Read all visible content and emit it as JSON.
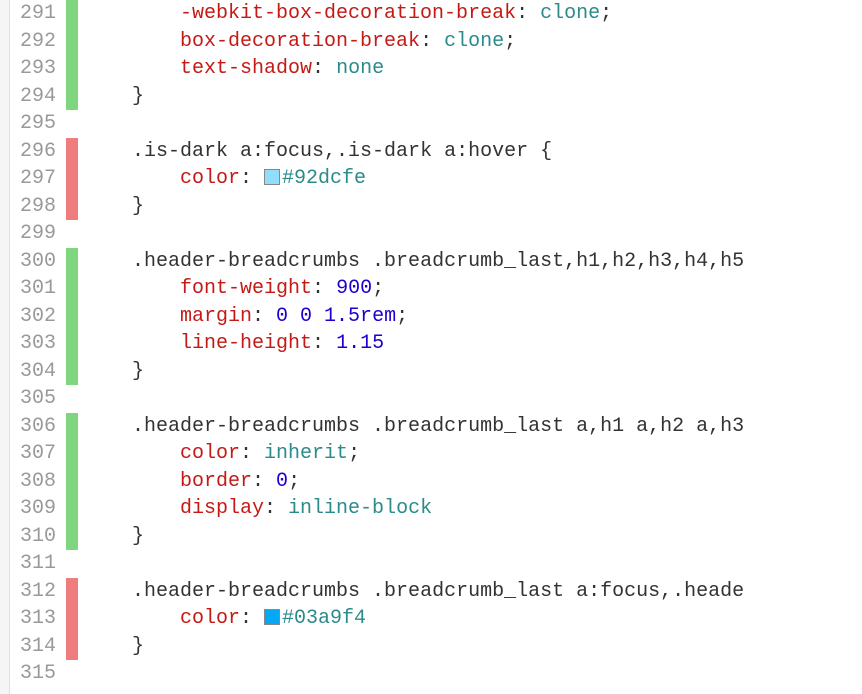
{
  "lines": [
    {
      "num": 291,
      "diff": "green",
      "tokens": [
        [
          "pad",
          "        "
        ],
        [
          "prop",
          "-webkit-box-decoration-break"
        ],
        [
          "punc",
          ": "
        ],
        [
          "val-kw",
          "clone"
        ],
        [
          "punc",
          ";"
        ]
      ]
    },
    {
      "num": 292,
      "diff": "green",
      "tokens": [
        [
          "pad",
          "        "
        ],
        [
          "prop",
          "box-decoration-break"
        ],
        [
          "punc",
          ": "
        ],
        [
          "val-kw",
          "clone"
        ],
        [
          "punc",
          ";"
        ]
      ]
    },
    {
      "num": 293,
      "diff": "green",
      "tokens": [
        [
          "pad",
          "        "
        ],
        [
          "prop",
          "text-shadow"
        ],
        [
          "punc",
          ": "
        ],
        [
          "val-kw",
          "none"
        ]
      ]
    },
    {
      "num": 294,
      "diff": "green",
      "tokens": [
        [
          "pad",
          "    "
        ],
        [
          "punc",
          "}"
        ]
      ]
    },
    {
      "num": 295,
      "diff": "",
      "tokens": []
    },
    {
      "num": 296,
      "diff": "red",
      "tokens": [
        [
          "pad",
          "    "
        ],
        [
          "sel",
          ".is-dark a:focus,.is-dark a:hover "
        ],
        [
          "punc",
          "{"
        ]
      ]
    },
    {
      "num": 297,
      "diff": "red",
      "tokens": [
        [
          "pad",
          "        "
        ],
        [
          "prop",
          "color"
        ],
        [
          "punc",
          ": "
        ],
        [
          "swatch",
          "#92dcfe"
        ],
        [
          "hex",
          "#92dcfe"
        ]
      ]
    },
    {
      "num": 298,
      "diff": "red",
      "tokens": [
        [
          "pad",
          "    "
        ],
        [
          "punc",
          "}"
        ]
      ]
    },
    {
      "num": 299,
      "diff": "",
      "tokens": []
    },
    {
      "num": 300,
      "diff": "green",
      "tokens": [
        [
          "pad",
          "    "
        ],
        [
          "sel",
          ".header-breadcrumbs .breadcrumb_last,h1,h2,h3,h4,h5"
        ]
      ]
    },
    {
      "num": 301,
      "diff": "green",
      "tokens": [
        [
          "pad",
          "        "
        ],
        [
          "prop",
          "font-weight"
        ],
        [
          "punc",
          ": "
        ],
        [
          "val-num",
          "900"
        ],
        [
          "punc",
          ";"
        ]
      ]
    },
    {
      "num": 302,
      "diff": "green",
      "tokens": [
        [
          "pad",
          "        "
        ],
        [
          "prop",
          "margin"
        ],
        [
          "punc",
          ": "
        ],
        [
          "val-num",
          "0 0 1.5rem"
        ],
        [
          "punc",
          ";"
        ]
      ]
    },
    {
      "num": 303,
      "diff": "green",
      "tokens": [
        [
          "pad",
          "        "
        ],
        [
          "prop",
          "line-height"
        ],
        [
          "punc",
          ": "
        ],
        [
          "val-num",
          "1.15"
        ]
      ]
    },
    {
      "num": 304,
      "diff": "green",
      "tokens": [
        [
          "pad",
          "    "
        ],
        [
          "punc",
          "}"
        ]
      ]
    },
    {
      "num": 305,
      "diff": "",
      "tokens": []
    },
    {
      "num": 306,
      "diff": "green",
      "tokens": [
        [
          "pad",
          "    "
        ],
        [
          "sel",
          ".header-breadcrumbs .breadcrumb_last a,h1 a,h2 a,h3"
        ]
      ]
    },
    {
      "num": 307,
      "diff": "green",
      "tokens": [
        [
          "pad",
          "        "
        ],
        [
          "prop",
          "color"
        ],
        [
          "punc",
          ": "
        ],
        [
          "inherit",
          "inherit"
        ],
        [
          "punc",
          ";"
        ]
      ]
    },
    {
      "num": 308,
      "diff": "green",
      "tokens": [
        [
          "pad",
          "        "
        ],
        [
          "prop",
          "border"
        ],
        [
          "punc",
          ": "
        ],
        [
          "val-num",
          "0"
        ],
        [
          "punc",
          ";"
        ]
      ]
    },
    {
      "num": 309,
      "diff": "green",
      "tokens": [
        [
          "pad",
          "        "
        ],
        [
          "prop",
          "display"
        ],
        [
          "punc",
          ": "
        ],
        [
          "val-kw",
          "inline-block"
        ]
      ]
    },
    {
      "num": 310,
      "diff": "green",
      "tokens": [
        [
          "pad",
          "    "
        ],
        [
          "punc",
          "}"
        ]
      ]
    },
    {
      "num": 311,
      "diff": "",
      "tokens": []
    },
    {
      "num": 312,
      "diff": "red",
      "tokens": [
        [
          "pad",
          "    "
        ],
        [
          "sel",
          ".header-breadcrumbs .breadcrumb_last a:focus,.heade"
        ]
      ]
    },
    {
      "num": 313,
      "diff": "red",
      "tokens": [
        [
          "pad",
          "        "
        ],
        [
          "prop",
          "color"
        ],
        [
          "punc",
          ": "
        ],
        [
          "swatch",
          "#03a9f4"
        ],
        [
          "hex",
          "#03a9f4"
        ]
      ]
    },
    {
      "num": 314,
      "diff": "red",
      "tokens": [
        [
          "pad",
          "    "
        ],
        [
          "punc",
          "}"
        ]
      ]
    },
    {
      "num": 315,
      "diff": "",
      "tokens": []
    }
  ]
}
